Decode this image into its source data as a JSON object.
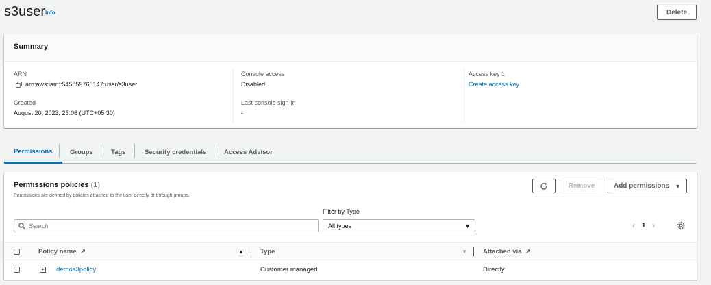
{
  "header": {
    "title": "s3user",
    "info_label": "Info",
    "delete_label": "Delete"
  },
  "summary": {
    "title": "Summary",
    "arn_label": "ARN",
    "arn_value": "arn:aws:iam::545859768147:user/s3user",
    "created_label": "Created",
    "created_value": "August 20, 2023, 23:08 (UTC+05:30)",
    "console_access_label": "Console access",
    "console_access_value": "Disabled",
    "last_signin_label": "Last console sign-in",
    "last_signin_value": "-",
    "access_key_label": "Access key 1",
    "access_key_link": "Create access key"
  },
  "tabs": [
    {
      "label": "Permissions",
      "active": true
    },
    {
      "label": "Groups",
      "active": false
    },
    {
      "label": "Tags",
      "active": false
    },
    {
      "label": "Security credentials",
      "active": false
    },
    {
      "label": "Access Advisor",
      "active": false
    }
  ],
  "permissions": {
    "title": "Permissions policies",
    "count": "(1)",
    "description": "Permissions are defined by policies attached to the user directly or through groups.",
    "remove_label": "Remove",
    "add_label": "Add permissions",
    "filter_label": "Filter by Type",
    "search_placeholder": "Search",
    "filter_value": "All types",
    "page": "1",
    "columns": {
      "policy_name": "Policy name",
      "type": "Type",
      "attached_via": "Attached via"
    },
    "rows": [
      {
        "policy_name": "demos3policy",
        "type": "Customer managed",
        "attached_via": "Directly"
      }
    ]
  },
  "colors": {
    "link": "#0073bb",
    "text": "#16191f",
    "muted": "#545b64",
    "background": "#f2f3f3"
  }
}
